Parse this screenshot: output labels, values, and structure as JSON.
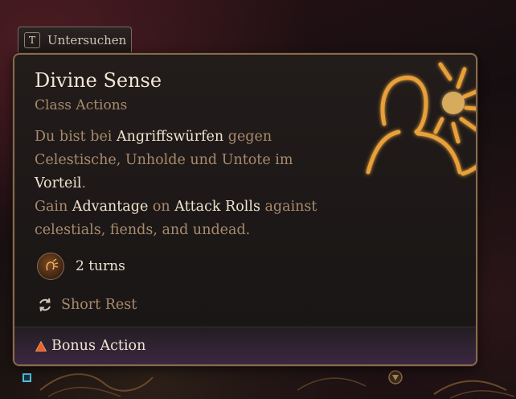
{
  "tab": {
    "key": "T",
    "label": "Untersuchen"
  },
  "spell": {
    "title": "Divine Sense",
    "subtitle": "Class Actions",
    "description_de": {
      "p1": "Du bist bei ",
      "h1": "Angriffswürfen",
      "p2": " gegen Celestische, Unholde und Untote im ",
      "h2": "Vorteil",
      "p3": "."
    },
    "description_en": {
      "p1": "Gain ",
      "h1": "Advantage",
      "p2": " on ",
      "h2": "Attack Rolls",
      "p3": " against celestials, fiends, and undead."
    },
    "duration": "2 turns",
    "recharge": "Short Rest",
    "cost": "Bonus Action"
  },
  "colors": {
    "accent_gold": "#e8a03a",
    "text_highlight": "#efe3cf",
    "text_muted": "#a88a6c",
    "border": "#8a6a4a",
    "bonus_action": "#e8632a"
  },
  "icons": {
    "spell_art": "divine-sense-icon",
    "duration": "duration-icon",
    "recharge": "short-rest-icon",
    "cost": "bonus-action-triangle-icon"
  }
}
